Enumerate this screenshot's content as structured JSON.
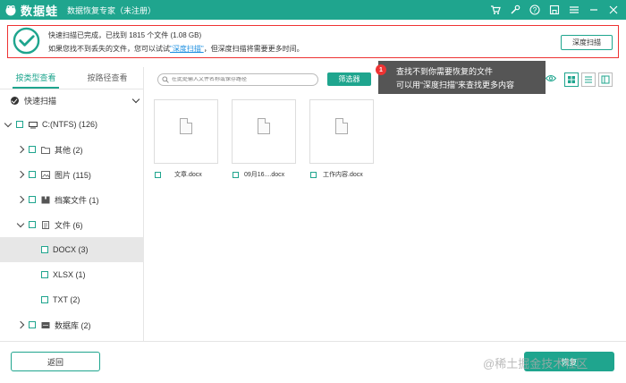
{
  "app": {
    "logo_text": "数据蛙",
    "subtitle": "数据恢复专家（未注册）",
    "brand_color": "#1fa58e",
    "window_icons": [
      "cart-icon",
      "wrench-icon",
      "help-icon",
      "save-icon",
      "menu-icon",
      "minimize-icon",
      "close-icon"
    ]
  },
  "banner": {
    "line1": "快速扫描已完成，已找到 1815 个文件 (1.08 GB)",
    "line2_prefix": "如果您找不到丢失的文件，您可以试试",
    "line2_link": "\"深度扫描\"",
    "line2_suffix": "，但深度扫描将需要更多时间。",
    "deep_scan_label": "深度扫描"
  },
  "left_panel": {
    "tabs": [
      {
        "label": "按类型查看"
      },
      {
        "label": "按路径查看"
      }
    ],
    "scan_mode": "快速扫描",
    "tree": [
      {
        "label": "C:(NTFS) (126)",
        "icon": "drive-icon"
      },
      {
        "label": "其他 (2)",
        "icon": "folder-icon"
      },
      {
        "label": "图片 (115)",
        "icon": "image-icon"
      },
      {
        "label": "档案文件 (1)",
        "icon": "archive-icon"
      },
      {
        "label": "文件 (6)",
        "icon": "document-icon"
      },
      {
        "label": "DOCX (3)"
      },
      {
        "label": "XLSX (1)"
      },
      {
        "label": "TXT (2)"
      },
      {
        "label": "数据库 (2)",
        "icon": "database-icon"
      }
    ]
  },
  "toolbar": {
    "search_placeholder": "在此处输入文件名称或保存路径",
    "filter_label": "筛选器"
  },
  "tooltip": {
    "badge": "1",
    "line1": "查找不到你需要恢复的文件",
    "line2": "可以用“深度扫描”来查找更多内容"
  },
  "files": [
    {
      "name": "文章.docx"
    },
    {
      "name": "09月16....docx"
    },
    {
      "name": "工作内容.docx"
    }
  ],
  "bottom": {
    "back_label": "返回",
    "recover_label": "恢复",
    "watermark": "@稀土掘金技术社区"
  }
}
